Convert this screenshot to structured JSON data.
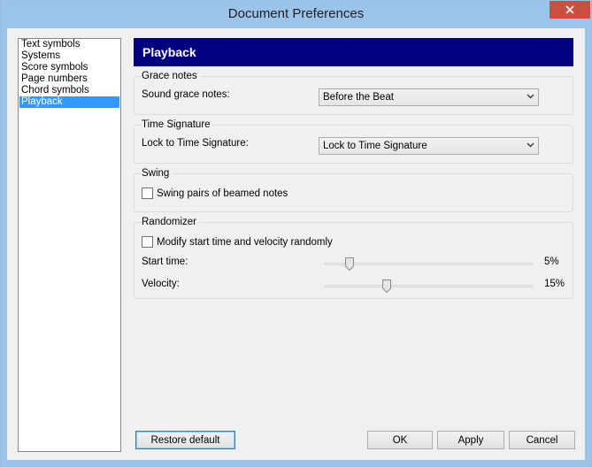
{
  "window": {
    "title": "Document Preferences"
  },
  "nav": {
    "items": [
      {
        "label": "Text symbols"
      },
      {
        "label": "Systems"
      },
      {
        "label": "Score symbols"
      },
      {
        "label": "Page numbers"
      },
      {
        "label": "Chord symbols"
      },
      {
        "label": "Playback",
        "selected": true
      }
    ]
  },
  "panel": {
    "title": "Playback",
    "grace_notes": {
      "group_label": "Grace notes",
      "field_label": "Sound grace notes:",
      "value": "Before the Beat"
    },
    "time_signature": {
      "group_label": "Time Signature",
      "field_label": "Lock to Time Signature:",
      "value": "Lock to Time Signature"
    },
    "swing": {
      "group_label": "Swing",
      "checkbox_label": "Swing pairs of beamed notes",
      "checked": false
    },
    "randomizer": {
      "group_label": "Randomizer",
      "checkbox_label": "Modify start time and velocity randomly",
      "checked": false,
      "start_time": {
        "label": "Start time:",
        "value_text": "5%",
        "fraction": 0.1
      },
      "velocity": {
        "label": "Velocity:",
        "value_text": "15%",
        "fraction": 0.29
      }
    }
  },
  "buttons": {
    "restore": "Restore default",
    "ok": "OK",
    "apply": "Apply",
    "cancel": "Cancel"
  },
  "colors": {
    "header_bg": "#000080",
    "selection": "#3399ff",
    "close_button": "#c7503f",
    "frame": "#9cc3ea"
  }
}
